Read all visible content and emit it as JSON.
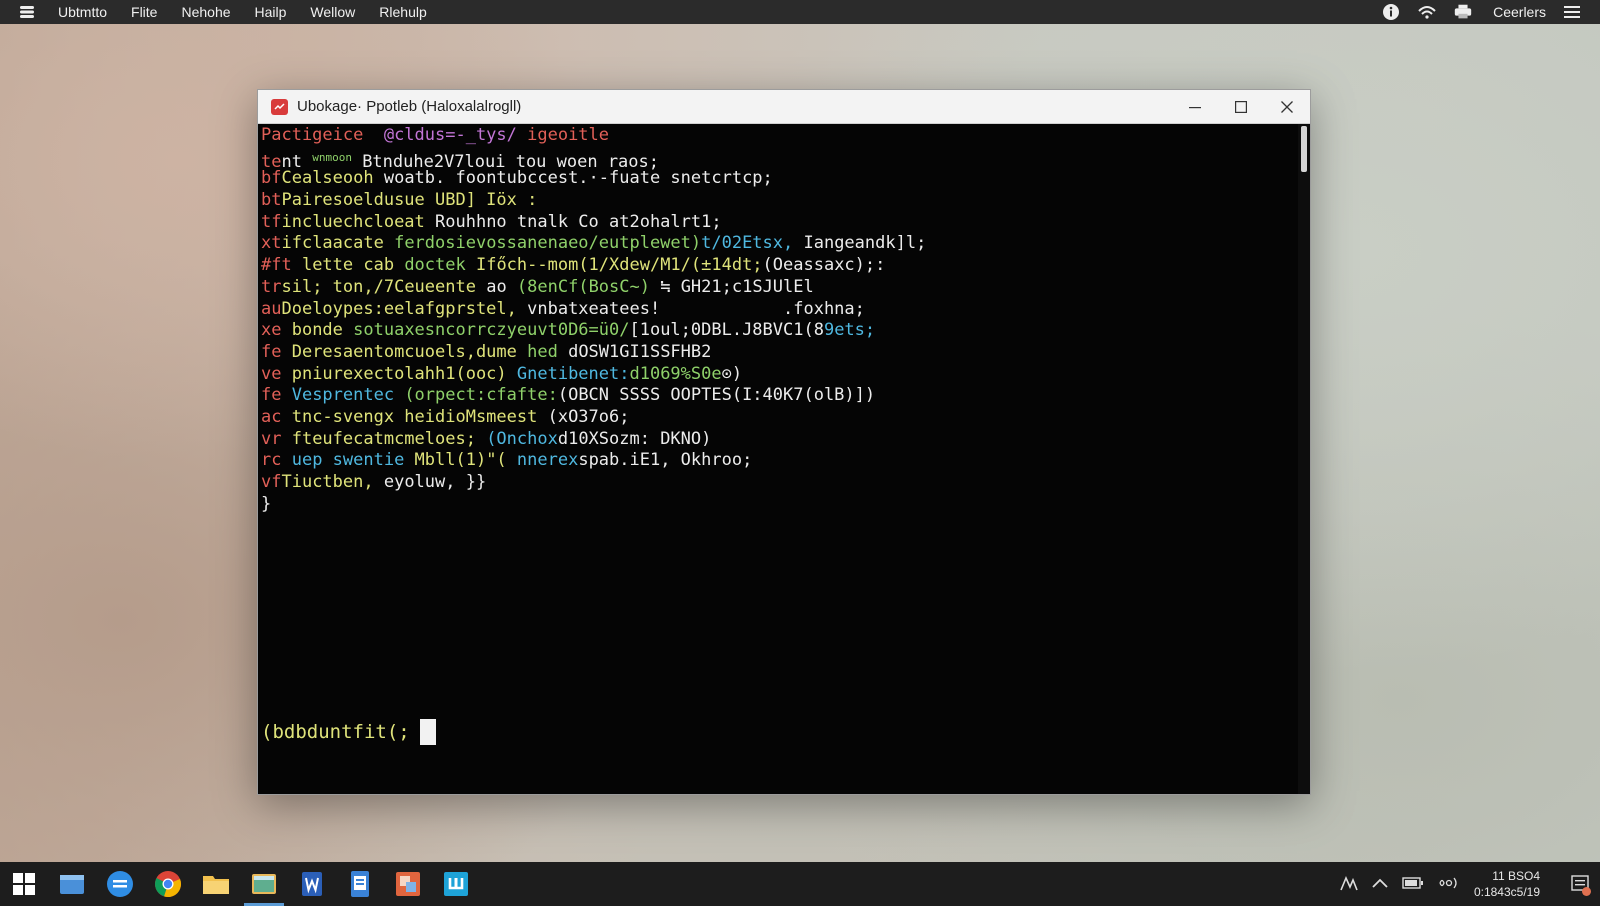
{
  "topbar": {
    "app_name": "Ubtmtto",
    "menu": [
      "Flite",
      "Nehohe",
      "Hailp",
      "Wellow",
      "Rlehulp"
    ],
    "user": "Ceerlers",
    "tray_icons": [
      "info-icon",
      "network-icon",
      "printer-icon",
      "menu-icon"
    ]
  },
  "window": {
    "title": "Ubokage· Ppotleb (Haloxalalrogll)",
    "controls": [
      "minimize",
      "maximize",
      "close"
    ],
    "accent": "#d83b3b"
  },
  "terminal": {
    "lines": [
      [
        {
          "t": "Pactigeice  ",
          "c": "p"
        },
        {
          "t": "@cldus=-_tys/ ",
          "c": "m"
        },
        {
          "t": "igeoitle",
          "c": "p"
        }
      ],
      [
        {
          "t": "te",
          "c": "p"
        },
        {
          "t": "nt ",
          "c": "w"
        },
        {
          "t": "wnmoon",
          "c": "g",
          "s": 1
        },
        {
          "t": " Btnduhe2V7loui tou woen raos;",
          "c": "w"
        }
      ],
      [
        {
          "t": "bf",
          "c": "p"
        },
        {
          "t": "Cealseooh ",
          "c": "y"
        },
        {
          "t": "woatb. foontubccest.·-fuate snetcrtcp;",
          "c": "w"
        }
      ],
      [
        {
          "t": "bt",
          "c": "p"
        },
        {
          "t": "Pairesoeldusue UBD] Iöx :",
          "c": "y"
        }
      ],
      [
        {
          "t": "tf",
          "c": "p"
        },
        {
          "t": "incluechcloeat ",
          "c": "y"
        },
        {
          "t": "Rouhhno tnalk Co at2ohalrt1;",
          "c": "w"
        }
      ],
      [
        {
          "t": "xt",
          "c": "p"
        },
        {
          "t": "ifclaacate ",
          "c": "y"
        },
        {
          "t": "ferdosievossanenaeo/eutplewet)",
          "c": "g"
        },
        {
          "t": "t/02Etsx, ",
          "c": "c"
        },
        {
          "t": "Iangeandk]l;",
          "c": "w"
        }
      ],
      [
        {
          "t": "#ft ",
          "c": "p"
        },
        {
          "t": "lette cab ",
          "c": "y"
        },
        {
          "t": "doctek ",
          "c": "g"
        },
        {
          "t": "Ifőch--mom(1/Xdew/M1/(±14dt;",
          "c": "y"
        },
        {
          "t": "(Oeassaxc);:",
          "c": "w"
        }
      ],
      [
        {
          "t": "tr",
          "c": "p"
        },
        {
          "t": "sil; ",
          "c": "y"
        },
        {
          "t": "ton,/7Ceueente ",
          "c": "y"
        },
        {
          "t": "ao ",
          "c": "w"
        },
        {
          "t": "(8enCf(BosC~) ",
          "c": "g"
        },
        {
          "t": "≒ GH21;c1SJUlEl",
          "c": "w"
        }
      ],
      [
        {
          "t": "au",
          "c": "p"
        },
        {
          "t": "Doeloypes:eelafgprstel, ",
          "c": "y"
        },
        {
          "t": "vnbatxeatees!",
          "c": "w"
        },
        {
          "t": "            .foxhna;",
          "c": "w"
        }
      ],
      [
        {
          "t": "xe ",
          "c": "p"
        },
        {
          "t": "bonde ",
          "c": "y"
        },
        {
          "t": "sotuaxesncorrczyeuvt0D6=ü0/",
          "c": "g"
        },
        {
          "t": "[1oul;0DBL.J8BVC1(8",
          "c": "w"
        },
        {
          "t": "9ets;",
          "c": "c"
        }
      ],
      [
        {
          "t": "fe ",
          "c": "p"
        },
        {
          "t": "Deresaentomcuoels,dume ",
          "c": "y"
        },
        {
          "t": "hed ",
          "c": "g"
        },
        {
          "t": "dOSW1GI1SSFHB2",
          "c": "w"
        }
      ],
      [
        {
          "t": "ve ",
          "c": "p"
        },
        {
          "t": "pniurexectolahh1(ooc) ",
          "c": "y"
        },
        {
          "t": "Gnetibenet:",
          "c": "c"
        },
        {
          "t": "d1069%S0e",
          "c": "g"
        },
        {
          "t": "⊙)",
          "c": "w"
        }
      ],
      [
        {
          "t": "fe ",
          "c": "p"
        },
        {
          "t": "Vesprentec ",
          "c": "c"
        },
        {
          "t": "(orpect:cfafte:",
          "c": "g"
        },
        {
          "t": "(OBCN SSSS OOPTES(I:40K7(olB)])",
          "c": "w"
        }
      ],
      [
        {
          "t": "ac ",
          "c": "p"
        },
        {
          "t": "tnc-svengx heidioMsmeest ",
          "c": "y"
        },
        {
          "t": "(xO37o6;",
          "c": "w"
        }
      ],
      [
        {
          "t": "vr ",
          "c": "p"
        },
        {
          "t": "fteufecatmcmeloes; ",
          "c": "y"
        },
        {
          "t": "(Onchox",
          "c": "c"
        },
        {
          "t": "d10XSozm: DKNO)",
          "c": "w"
        }
      ],
      [
        {
          "t": "rc ",
          "c": "p"
        },
        {
          "t": "uep swentie ",
          "c": "c"
        },
        {
          "t": "Mbll(1)\"( ",
          "c": "y"
        },
        {
          "t": "nnerex",
          "c": "c"
        },
        {
          "t": "spab.iE1, Okhroo;",
          "c": "w"
        }
      ],
      [
        {
          "t": "vf",
          "c": "p"
        },
        {
          "t": "Tiuctben, ",
          "c": "y"
        },
        {
          "t": "eyoluw, }}",
          "c": "w"
        }
      ],
      [
        {
          "t": "}",
          "c": "w"
        }
      ]
    ],
    "prompt": "(bdbduntfit(;"
  },
  "taskbar": {
    "apps": [
      "windows-start-icon",
      "file-manager-icon",
      "edge-icon",
      "chrome-icon",
      "folder-icon",
      "photos-icon",
      "word-icon",
      "document-icon",
      "paint-icon",
      "store-icon"
    ],
    "clock_time": "11 BSO4",
    "clock_date": "0:1843c5/19"
  }
}
